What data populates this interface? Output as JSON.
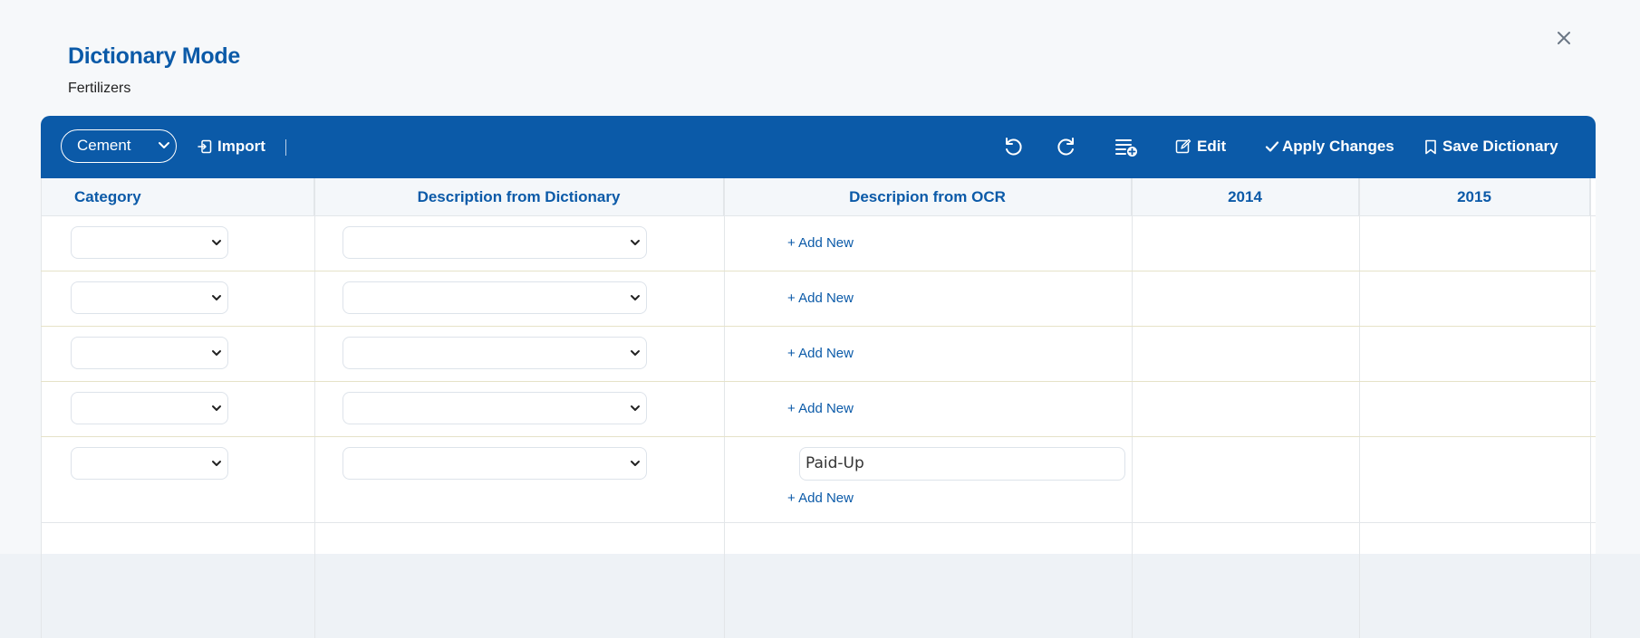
{
  "header": {
    "title": "Dictionary Mode",
    "subtitle": "Fertilizers",
    "close_icon": "close-icon"
  },
  "toolbar": {
    "dictionary_select": "Cement",
    "import_label": "Import",
    "edit_label": "Edit",
    "apply_label": "Apply Changes",
    "save_label": "Save Dictionary",
    "icons": [
      "undo-icon",
      "redo-icon",
      "add-list-icon"
    ]
  },
  "table": {
    "columns": [
      "Category",
      "Description from Dictionary",
      "Descripion from OCR",
      "2014",
      "2015"
    ],
    "rows": [
      {
        "category": "",
        "dictionary_description": "",
        "ocr_value": "",
        "add_label": "+ Add New",
        "y2014": "",
        "y2015": ""
      },
      {
        "category": "",
        "dictionary_description": "",
        "ocr_value": "",
        "add_label": "+ Add New",
        "y2014": "",
        "y2015": ""
      },
      {
        "category": "",
        "dictionary_description": "",
        "ocr_value": "",
        "add_label": "+ Add New",
        "y2014": "",
        "y2015": ""
      },
      {
        "category": "",
        "dictionary_description": "",
        "ocr_value": "",
        "add_label": "+ Add New",
        "y2014": "",
        "y2015": ""
      },
      {
        "category": "",
        "dictionary_description": "",
        "ocr_value": "Paid-Up",
        "add_label": "+ Add New",
        "y2014": "",
        "y2015": ""
      }
    ]
  },
  "colors": {
    "primary": "#0b5aa8",
    "toolbar_text": "#ffffff",
    "row_border": "#e6e2c8"
  }
}
